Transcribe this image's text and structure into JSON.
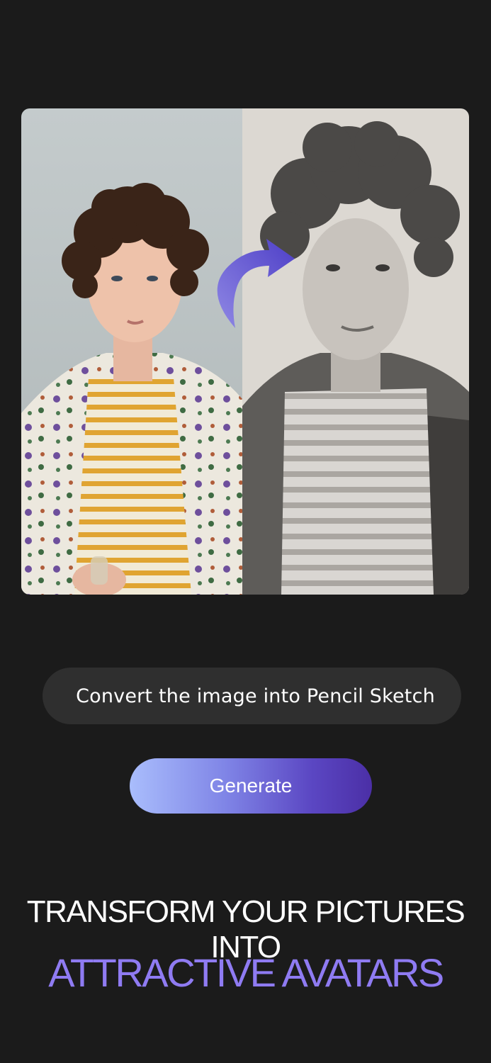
{
  "comparison": {
    "before_image": "photo-of-young-man-with-curly-hair-in-floral-shirt",
    "after_image": "pencil-sketch-portrait",
    "arrow_icon": "curved-arrow-right-icon",
    "arrow_color": "#5b4fd6"
  },
  "prompt": {
    "text": "Convert the image into Pencil Sketch"
  },
  "generate_button": {
    "label": "Generate"
  },
  "headline": {
    "line1": "TRANSFORM YOUR PICTURES INTO",
    "line2": "ATTRACTIVE AVATARS",
    "accent_color": "#8f7bf2"
  }
}
